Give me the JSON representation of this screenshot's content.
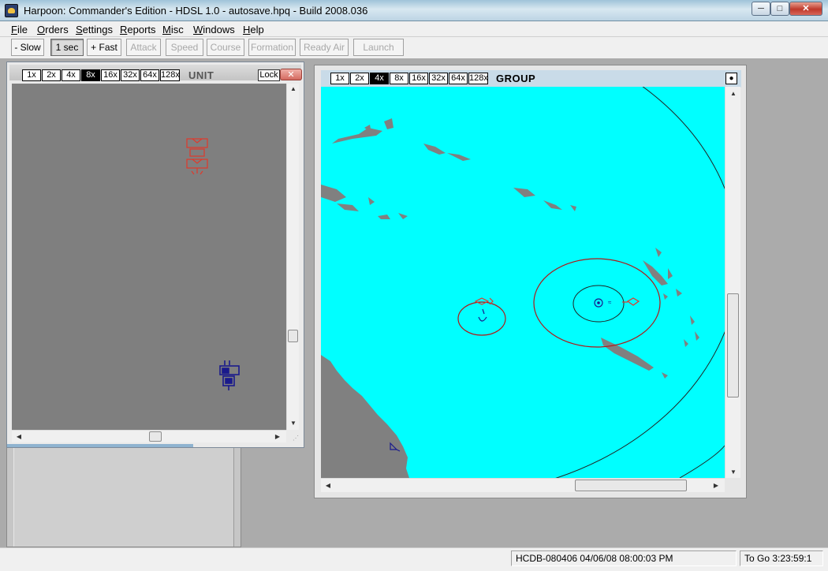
{
  "window": {
    "title": "Harpoon: Commander's Edition - HDSL 1.0 - autosave.hpq - Build 2008.036",
    "minimize": "─",
    "maximize": "□",
    "close": "✕"
  },
  "menu": [
    "File",
    "Orders",
    "Settings",
    "Reports",
    "Misc",
    "Windows",
    "Help"
  ],
  "toolbar": {
    "buttons": [
      "- Slow",
      "1 sec",
      "+ Fast",
      "Attack",
      "Speed",
      "Course",
      "Formation",
      "Ready Air",
      "Launch"
    ],
    "pressed": "1 sec",
    "disabled": [
      "Attack",
      "Speed",
      "Course",
      "Formation",
      "Ready Air",
      "Launch"
    ]
  },
  "unit_window": {
    "zoom_levels": [
      "1x",
      "2x",
      "4x",
      "8x",
      "16x",
      "32x",
      "64x",
      "128x"
    ],
    "active_zoom": "8x",
    "title": "UNIT",
    "lock_label": "Lock",
    "close_label": "✕"
  },
  "group_window": {
    "zoom_levels": [
      "1x",
      "2x",
      "4x",
      "8x",
      "16x",
      "32x",
      "64x",
      "128x"
    ],
    "active_zoom": "4x",
    "title": "GROUP",
    "corner_button": "●"
  },
  "status": {
    "db_time": "HCDB-080406 04/06/08 08:00:03 PM",
    "to_go": "To Go 3:23:59:1"
  },
  "colors": {
    "sea": "#00ffff",
    "land": "#808080",
    "hostile": "#e0392b",
    "friendly": "#1a1a8c",
    "range_ring": "#b01818"
  }
}
